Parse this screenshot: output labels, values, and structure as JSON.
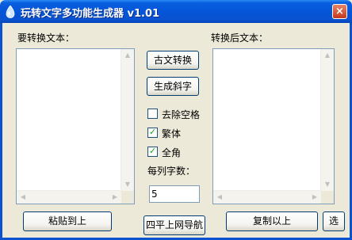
{
  "window": {
    "title": "玩转文字多功能生成器 v1.01",
    "close_glyph": "×"
  },
  "left": {
    "label": "要转换文本："
  },
  "right": {
    "label": "转换后文本："
  },
  "middle": {
    "classic_button": "古文转换",
    "italic_button": "生成斜字",
    "remove_spaces": {
      "label": "去除空格",
      "checked": false
    },
    "traditional": {
      "label": "繁体",
      "checked": true
    },
    "fullwidth": {
      "label": "全角",
      "checked": true
    },
    "chars_per_column_label": "每列字数：",
    "chars_per_column_value": "5"
  },
  "bottom": {
    "paste_button": "粘贴到上",
    "nav_button": "四平上网导航",
    "copy_button": "复制以上",
    "select_button": "选"
  },
  "icons": {
    "check_glyph": "✓",
    "scroll_up": "▲",
    "scroll_down": "▼",
    "scroll_left": "◀",
    "scroll_right": "▶"
  }
}
